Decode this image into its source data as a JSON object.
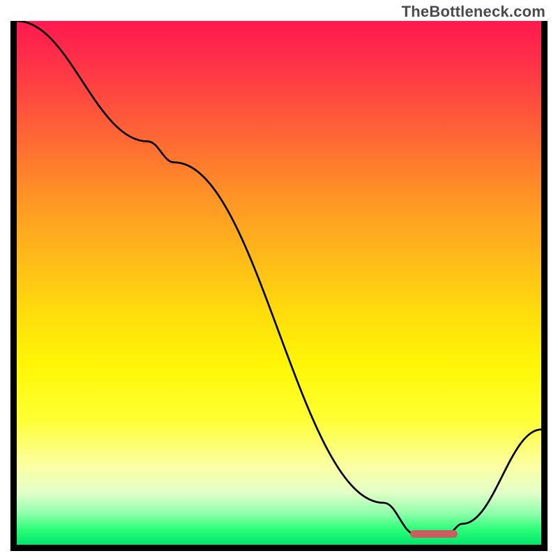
{
  "watermark": "TheBottleneck.com",
  "chart_data": {
    "type": "line",
    "title": "",
    "xlabel": "",
    "ylabel": "",
    "xlim": [
      0,
      100
    ],
    "ylim": [
      0,
      100
    ],
    "x": [
      0,
      25,
      30,
      70,
      76,
      82,
      85,
      100
    ],
    "values": [
      100,
      77,
      73,
      8,
      2,
      2,
      4,
      22
    ],
    "curve_note": "single black curve falling from top-left, flat minimum near x≈76–82, then rising; values are read off the gradient scale (0=bottom, 100=top)",
    "marker_segment": {
      "x_start": 75,
      "x_end": 84,
      "y": 1.3
    },
    "background_gradient": {
      "orientation": "vertical",
      "stops": [
        {
          "pos": 0,
          "color": "#ff194f"
        },
        {
          "pos": 50,
          "color": "#ffd000"
        },
        {
          "pos": 85,
          "color": "#fcff9a"
        },
        {
          "pos": 100,
          "color": "#00e46a"
        }
      ]
    },
    "axes_visible": false,
    "grid": false
  },
  "colors": {
    "marker": "#ca5d60",
    "curve": "#000000",
    "frame": "#000000",
    "watermark": "#4b4b4b"
  }
}
